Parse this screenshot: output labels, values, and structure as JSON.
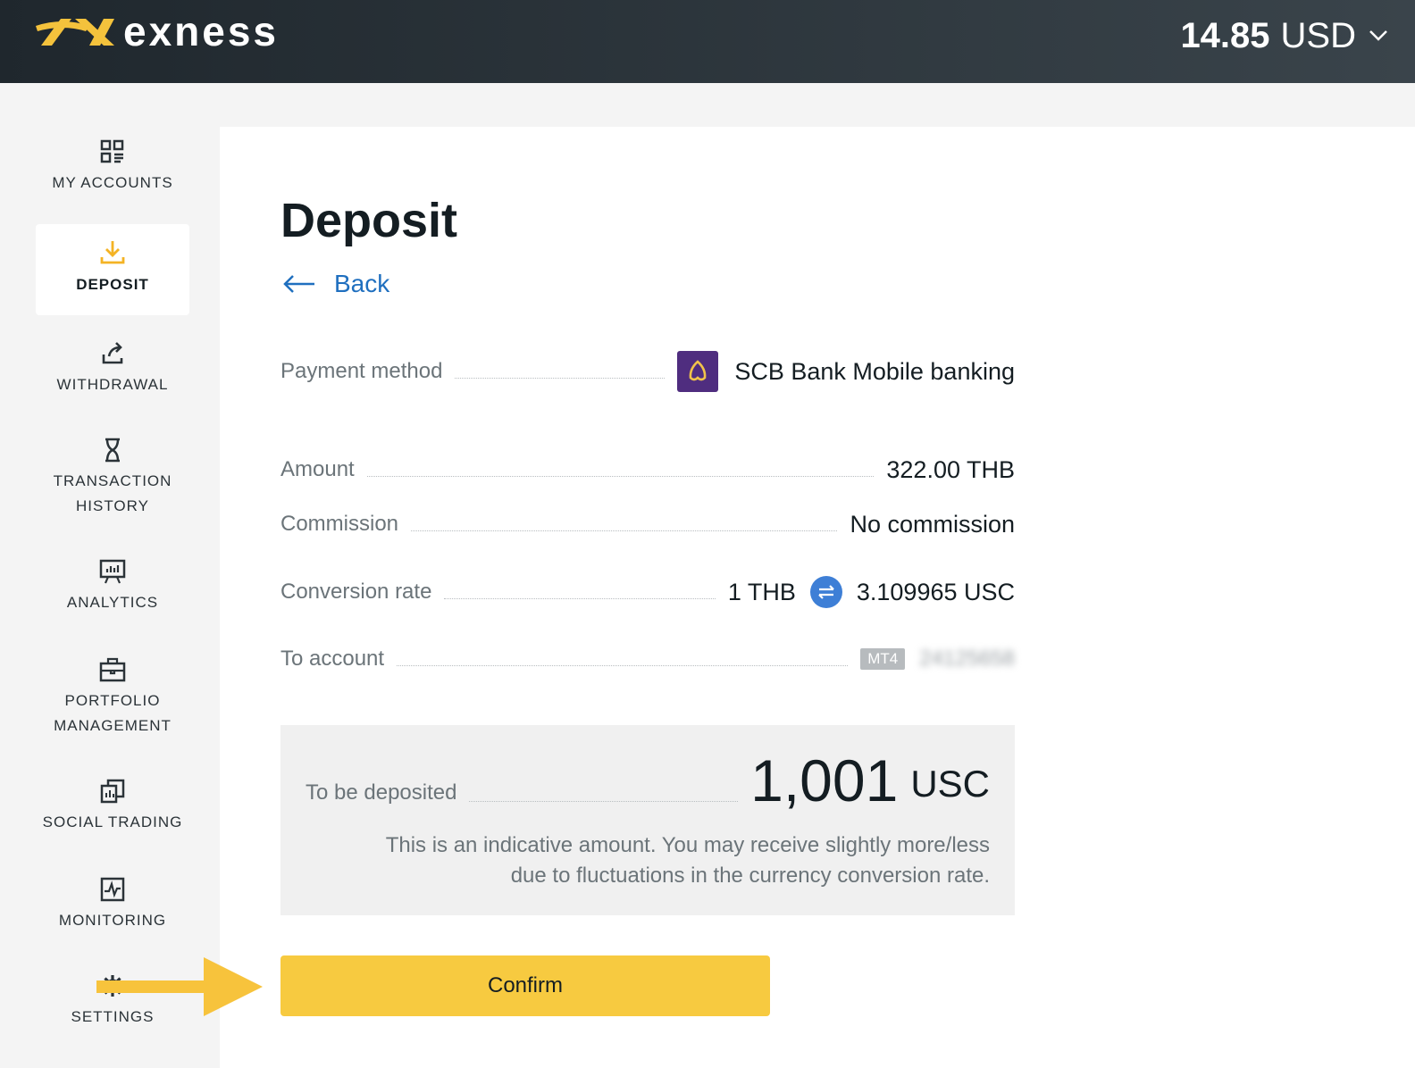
{
  "header": {
    "brand": "exness",
    "balance_amount": "14.85",
    "balance_currency": "USD"
  },
  "sidebar": {
    "items": [
      {
        "label": "MY ACCOUNTS",
        "icon": "accounts-grid-icon"
      },
      {
        "label": "DEPOSIT",
        "icon": "download-tray-icon",
        "active": true
      },
      {
        "label": "WITHDRAWAL",
        "icon": "upload-share-icon"
      },
      {
        "label": "TRANSACTION HISTORY",
        "icon": "hourglass-icon"
      },
      {
        "label": "ANALYTICS",
        "icon": "presentation-board-icon"
      },
      {
        "label": "PORTFOLIO MANAGEMENT",
        "icon": "briefcase-icon"
      },
      {
        "label": "SOCIAL TRADING",
        "icon": "copy-documents-icon"
      },
      {
        "label": "MONITORING",
        "icon": "pulse-chart-icon"
      },
      {
        "label": "SETTINGS",
        "icon": "gear-icon"
      }
    ]
  },
  "page": {
    "title": "Deposit",
    "back_label": "Back"
  },
  "details": {
    "payment_method_label": "Payment method",
    "payment_method_value": "SCB Bank Mobile banking",
    "amount_label": "Amount",
    "amount_value": "322.00 THB",
    "commission_label": "Commission",
    "commission_value": "No commission",
    "conversion_label": "Conversion rate",
    "conversion_from": "1 THB",
    "conversion_to": "3.109965 USC",
    "to_account_label": "To account",
    "account_platform": "MT4",
    "account_number": "24125658"
  },
  "summary": {
    "label": "To be deposited",
    "amount": "1,001",
    "unit": "USC",
    "note_line1": "This is an indicative amount. You may receive slightly more/less",
    "note_line2": "due to fluctuations in the currency conversion rate."
  },
  "actions": {
    "confirm_label": "Confirm"
  },
  "colors": {
    "accent_yellow": "#f7ca40",
    "link_blue": "#1f6fbf",
    "bank_purple": "#4f2d7f",
    "logo_yellow": "#f4c23c"
  }
}
